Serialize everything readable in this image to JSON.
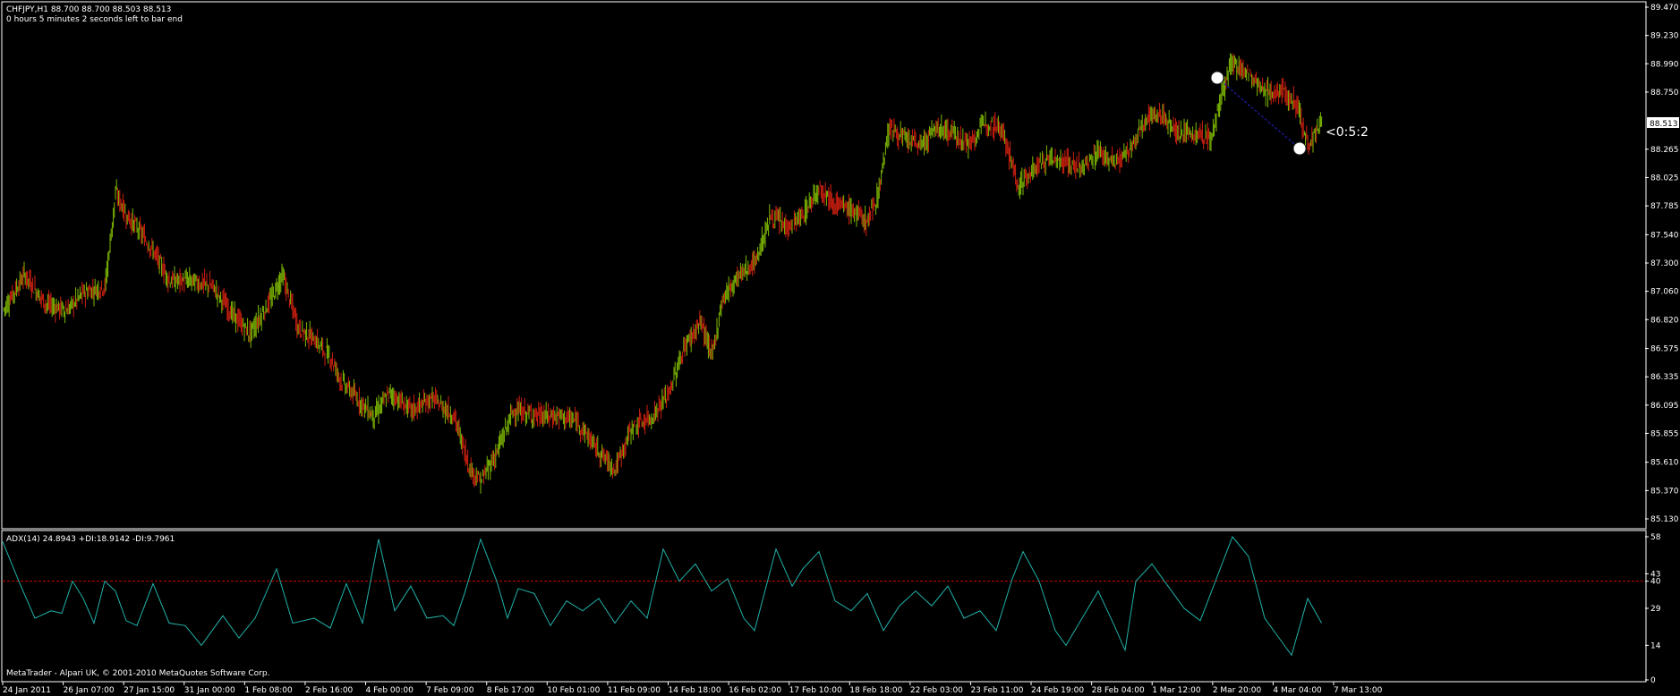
{
  "header": {
    "symbol_line": "CHFJPY,H1  88.700 88.700 88.503 88.513",
    "timer_line": "0 hours 5 minutes 2 seconds left to bar end"
  },
  "colors": {
    "background": "#000000",
    "frame": "#ffffff",
    "bull_candle": "#7fba00",
    "bear_candle": "#d02010",
    "adx_line": "#20b2aa",
    "adx_level_line": "#d00000",
    "pattern_line": "#1e1ea8"
  },
  "price_axis": {
    "ticks": [
      "89.470",
      "89.230",
      "88.990",
      "88.750",
      "88.265",
      "88.025",
      "87.785",
      "87.540",
      "87.300",
      "87.060",
      "86.820",
      "86.575",
      "86.335",
      "86.095",
      "85.855",
      "85.610",
      "85.370",
      "85.130"
    ],
    "current_price": "88.513"
  },
  "time_axis": {
    "labels": [
      "24 Jan 2011",
      "26 Jan 07:00",
      "27 Jan 15:00",
      "31 Jan 00:00",
      "1 Feb 08:00",
      "2 Feb 16:00",
      "4 Feb 00:00",
      "7 Feb 09:00",
      "8 Feb 17:00",
      "10 Feb 01:00",
      "11 Feb 09:00",
      "14 Feb 18:00",
      "16 Feb 02:00",
      "17 Feb 10:00",
      "18 Feb 18:00",
      "22 Feb 03:00",
      "23 Feb 11:00",
      "24 Feb 19:00",
      "28 Feb 04:00",
      "1 Mar 12:00",
      "2 Mar 20:00",
      "4 Mar 04:00",
      "7 Mar 13:00"
    ]
  },
  "annotation": {
    "label": "<0:5:2"
  },
  "indicator": {
    "title": "ADX(14) 24.8943 +DI:18.9142 -DI:9.7961",
    "ticks": [
      "58",
      "43",
      "40",
      "29",
      "14",
      "0"
    ],
    "level": 40
  },
  "footer": {
    "copyright": "MetaTrader - Alpari UK, © 2001-2010 MetaQuotes Software Corp."
  },
  "chart_data": [
    {
      "type": "candlestick",
      "title": "CHFJPY,H1",
      "ylim": [
        85.13,
        89.47
      ],
      "approx_close_path": [
        [
          0,
          86.9
        ],
        [
          20,
          87.2
        ],
        [
          40,
          86.95
        ],
        [
          60,
          86.9
        ],
        [
          75,
          87.05
        ],
        [
          95,
          87.1
        ],
        [
          105,
          87.9
        ],
        [
          115,
          87.7
        ],
        [
          125,
          87.6
        ],
        [
          140,
          87.4
        ],
        [
          155,
          87.15
        ],
        [
          175,
          87.15
        ],
        [
          195,
          87.1
        ],
        [
          215,
          86.85
        ],
        [
          230,
          86.7
        ],
        [
          250,
          87.0
        ],
        [
          260,
          87.2
        ],
        [
          275,
          86.75
        ],
        [
          290,
          86.65
        ],
        [
          305,
          86.5
        ],
        [
          315,
          86.3
        ],
        [
          330,
          86.15
        ],
        [
          345,
          86.0
        ],
        [
          360,
          86.2
        ],
        [
          380,
          86.05
        ],
        [
          400,
          86.15
        ],
        [
          420,
          86.0
        ],
        [
          435,
          85.55
        ],
        [
          445,
          85.45
        ],
        [
          460,
          85.7
        ],
        [
          475,
          86.05
        ],
        [
          500,
          86.0
        ],
        [
          520,
          86.0
        ],
        [
          535,
          85.95
        ],
        [
          555,
          85.7
        ],
        [
          570,
          85.55
        ],
        [
          585,
          85.9
        ],
        [
          605,
          86.0
        ],
        [
          620,
          86.2
        ],
        [
          635,
          86.6
        ],
        [
          650,
          86.8
        ],
        [
          660,
          86.5
        ],
        [
          670,
          87.0
        ],
        [
          685,
          87.2
        ],
        [
          700,
          87.3
        ],
        [
          715,
          87.7
        ],
        [
          730,
          87.6
        ],
        [
          745,
          87.7
        ],
        [
          760,
          87.95
        ],
        [
          775,
          87.8
        ],
        [
          790,
          87.75
        ],
        [
          805,
          87.65
        ],
        [
          815,
          87.9
        ],
        [
          825,
          88.45
        ],
        [
          840,
          88.35
        ],
        [
          855,
          88.3
        ],
        [
          870,
          88.45
        ],
        [
          885,
          88.4
        ],
        [
          900,
          88.3
        ],
        [
          915,
          88.5
        ],
        [
          930,
          88.45
        ],
        [
          945,
          87.95
        ],
        [
          960,
          88.1
        ],
        [
          975,
          88.2
        ],
        [
          990,
          88.15
        ],
        [
          1005,
          88.1
        ],
        [
          1020,
          88.25
        ],
        [
          1035,
          88.15
        ],
        [
          1050,
          88.25
        ],
        [
          1065,
          88.55
        ],
        [
          1080,
          88.55
        ],
        [
          1095,
          88.4
        ],
        [
          1110,
          88.4
        ],
        [
          1125,
          88.35
        ],
        [
          1135,
          88.75
        ],
        [
          1145,
          89.0
        ],
        [
          1160,
          88.9
        ],
        [
          1175,
          88.75
        ],
        [
          1190,
          88.75
        ],
        [
          1205,
          88.65
        ],
        [
          1215,
          88.3
        ],
        [
          1228,
          88.5
        ]
      ]
    },
    {
      "type": "line",
      "title": "ADX(14)",
      "ylim": [
        0,
        58
      ],
      "series": [
        {
          "name": "ADX(14)",
          "values": [
            [
              0,
              56
            ],
            [
              15,
              40
            ],
            [
              30,
              25
            ],
            [
              45,
              28
            ],
            [
              55,
              27
            ],
            [
              65,
              40
            ],
            [
              75,
              33
            ],
            [
              85,
              23
            ],
            [
              95,
              40
            ],
            [
              105,
              36
            ],
            [
              115,
              24
            ],
            [
              125,
              22
            ],
            [
              140,
              39
            ],
            [
              155,
              23
            ],
            [
              170,
              22
            ],
            [
              185,
              14
            ],
            [
              205,
              26
            ],
            [
              220,
              17
            ],
            [
              235,
              25
            ],
            [
              255,
              45
            ],
            [
              270,
              23
            ],
            [
              290,
              25
            ],
            [
              305,
              21
            ],
            [
              320,
              39
            ],
            [
              335,
              23
            ],
            [
              350,
              57
            ],
            [
              365,
              28
            ],
            [
              380,
              38
            ],
            [
              395,
              25
            ],
            [
              410,
              26
            ],
            [
              420,
              22
            ],
            [
              430,
              35
            ],
            [
              445,
              57
            ],
            [
              460,
              40
            ],
            [
              470,
              25
            ],
            [
              480,
              37
            ],
            [
              495,
              35
            ],
            [
              510,
              22
            ],
            [
              525,
              32
            ],
            [
              540,
              28
            ],
            [
              555,
              33
            ],
            [
              570,
              23
            ],
            [
              585,
              32
            ],
            [
              600,
              25
            ],
            [
              615,
              53
            ],
            [
              630,
              40
            ],
            [
              645,
              47
            ],
            [
              660,
              36
            ],
            [
              675,
              41
            ],
            [
              690,
              25
            ],
            [
              700,
              20
            ],
            [
              720,
              53
            ],
            [
              735,
              38
            ],
            [
              745,
              45
            ],
            [
              760,
              52
            ],
            [
              775,
              32
            ],
            [
              790,
              28
            ],
            [
              805,
              35
            ],
            [
              820,
              20
            ],
            [
              835,
              30
            ],
            [
              850,
              36
            ],
            [
              865,
              30
            ],
            [
              880,
              38
            ],
            [
              895,
              25
            ],
            [
              910,
              28
            ],
            [
              925,
              20
            ],
            [
              940,
              41
            ],
            [
              950,
              52
            ],
            [
              965,
              40
            ],
            [
              980,
              20
            ],
            [
              990,
              14
            ],
            [
              1005,
              25
            ],
            [
              1020,
              36
            ],
            [
              1035,
              22
            ],
            [
              1045,
              12
            ],
            [
              1055,
              40
            ],
            [
              1070,
              47
            ],
            [
              1085,
              38
            ],
            [
              1100,
              29
            ],
            [
              1115,
              24
            ],
            [
              1130,
              41
            ],
            [
              1145,
              58
            ],
            [
              1160,
              50
            ],
            [
              1175,
              25
            ],
            [
              1190,
              16
            ],
            [
              1200,
              10
            ],
            [
              1215,
              33
            ],
            [
              1228,
              23
            ]
          ]
        }
      ]
    }
  ]
}
